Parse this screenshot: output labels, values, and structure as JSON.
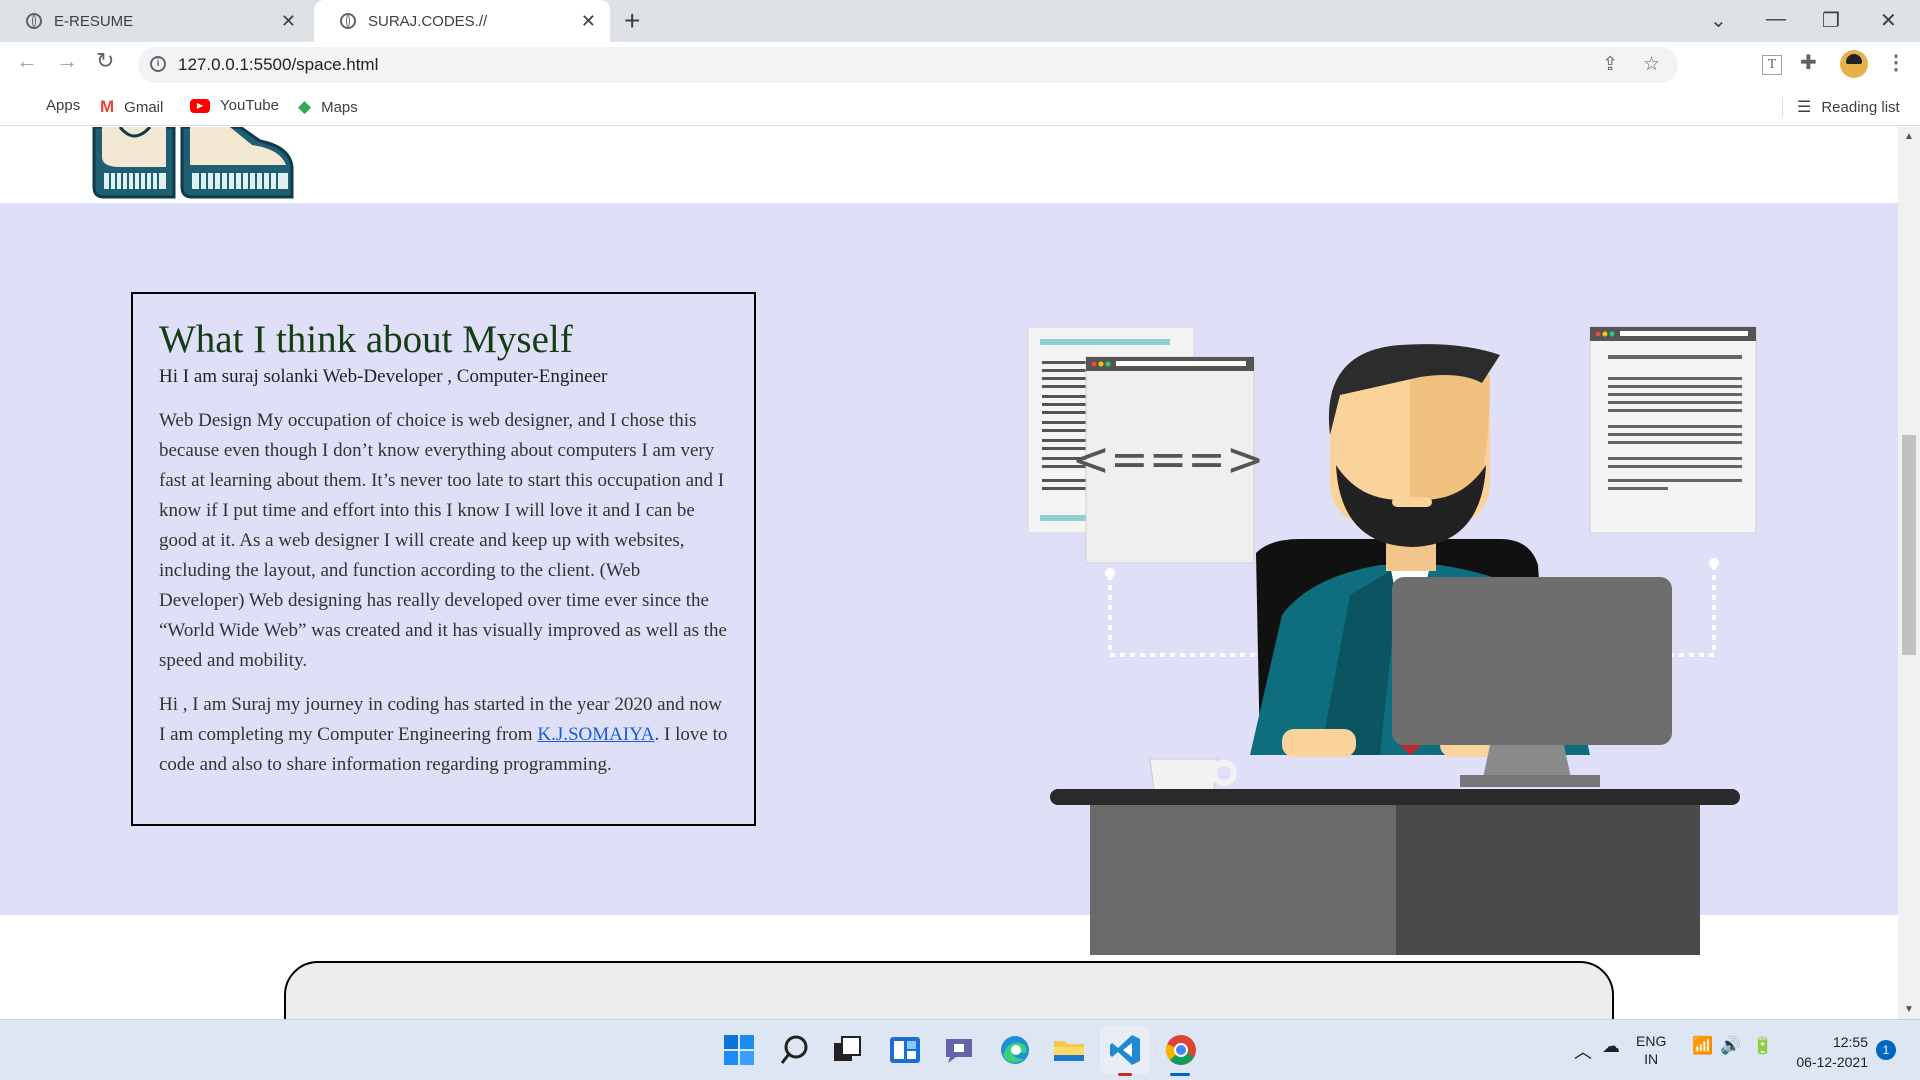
{
  "browser": {
    "tabs": [
      {
        "label": "E-RESUME",
        "active": false
      },
      {
        "label": "SURAJ.CODES.//",
        "active": true
      }
    ],
    "url": "127.0.0.1:5500/space.html",
    "bookmarks": [
      {
        "label": "Apps",
        "icon": "apps-grid-icon"
      },
      {
        "label": "Gmail",
        "icon": "gmail-icon"
      },
      {
        "label": "YouTube",
        "icon": "youtube-icon"
      },
      {
        "label": "Maps",
        "icon": "maps-icon"
      }
    ],
    "reading_list": "Reading list"
  },
  "about": {
    "title": "What I think about Myself",
    "subtitle": "Hi I am suraj solanki Web-Developer , Computer-Engineer",
    "paragraph1": "Web Design My occupation of choice is web designer, and I chose this because even though I don’t know everything about computers I am very fast at learning about them. It’s never too late to start this occupation and I know if I put time and effort into this I know I will love it and I can be good at it. As a web designer I will create and keep up with websites, including the layout, and function according to the client. (Web Developer) Web designing has really developed over time ever since the “World Wide Web” was created and it has visually improved as well as the speed and mobility.",
    "paragraph2_before": "Hi , I am Suraj my journey in coding has started in the year 2020 and now I am completing my Computer Engineering from ",
    "paragraph2_link": "K.J.SOMAIYA",
    "paragraph2_after": ". I love to code and also to share information regarding programming.",
    "background_color": "#dfdff7"
  },
  "illustration": {
    "code_symbol": "<===>"
  },
  "taskbar": {
    "icons": [
      "windows-start-icon",
      "search-icon",
      "task-view-icon",
      "widgets-icon",
      "teams-chat-icon",
      "edge-icon",
      "file-explorer-icon",
      "vscode-icon",
      "chrome-icon"
    ],
    "language": "ENG",
    "region": "IN",
    "time": "12:55",
    "date": "06-12-2021",
    "notification_count": "1"
  }
}
